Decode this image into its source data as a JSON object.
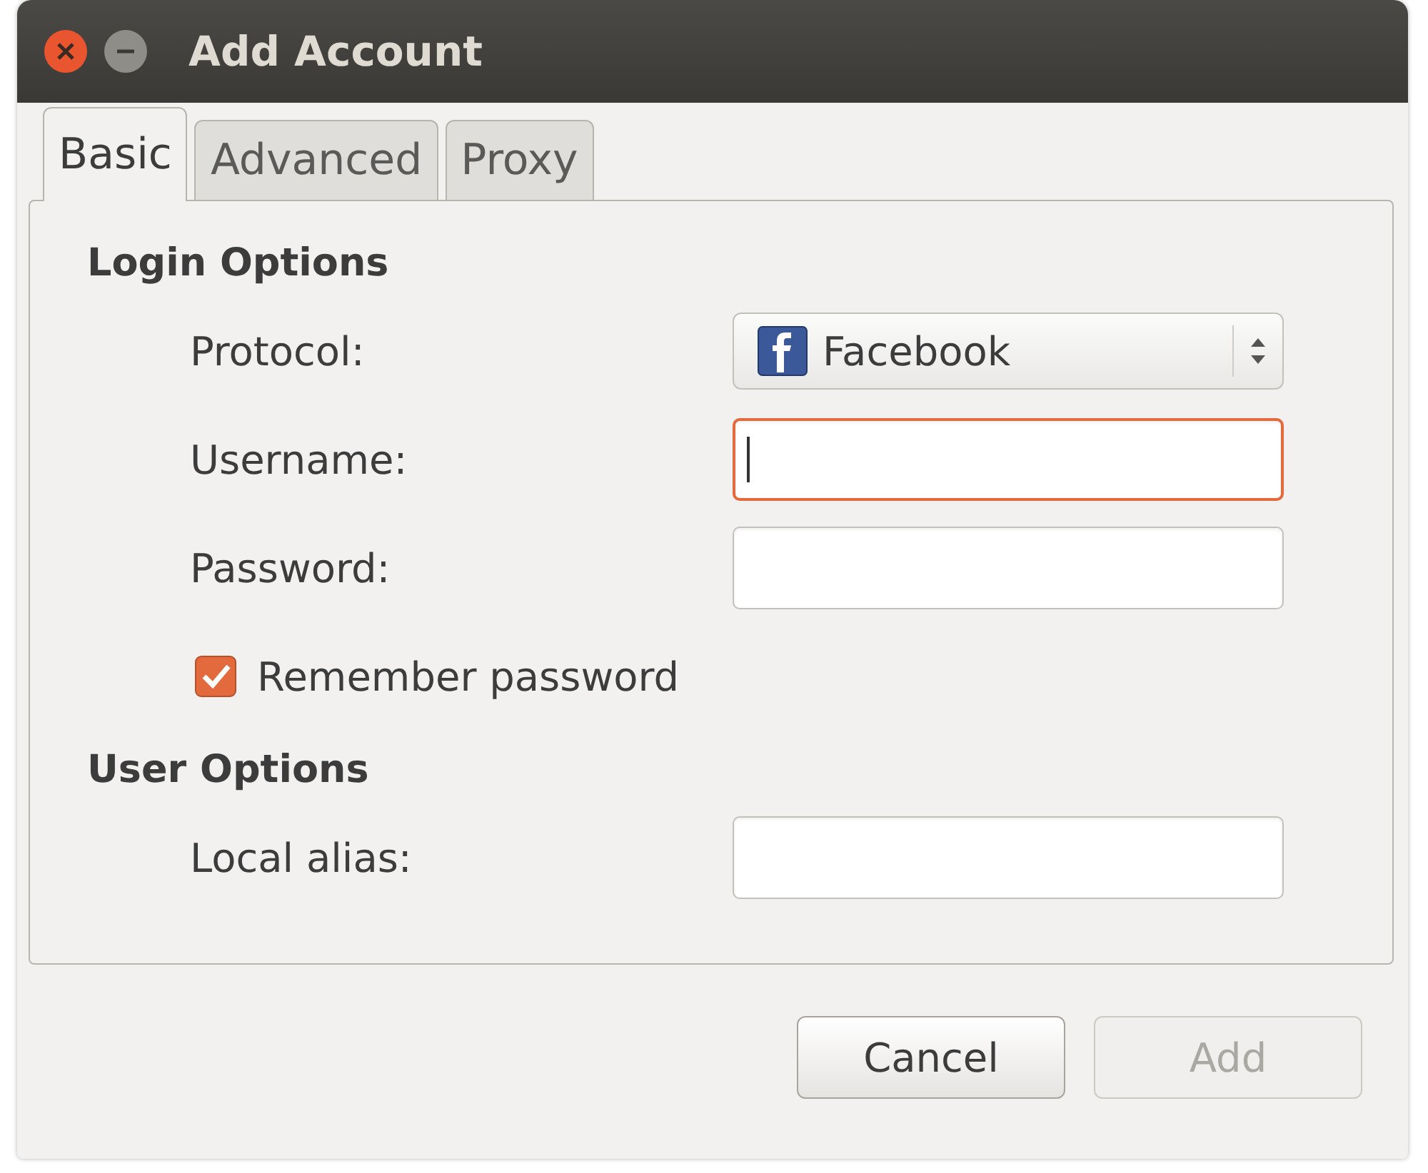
{
  "window": {
    "title": "Add Account"
  },
  "tabs": [
    {
      "label": "Basic",
      "selected": true
    },
    {
      "label": "Advanced",
      "selected": false
    },
    {
      "label": "Proxy",
      "selected": false
    }
  ],
  "sections": [
    {
      "title": "Login Options",
      "rows": [
        {
          "kind": "combo",
          "label": "Protocol:",
          "value": "Facebook"
        },
        {
          "kind": "entry",
          "label": "Username:",
          "focused": true
        },
        {
          "kind": "entry",
          "label": "Password:",
          "focused": false
        },
        {
          "kind": "check",
          "label": "Remember password",
          "checked": true
        }
      ]
    },
    {
      "title": "User Options",
      "rows": [
        {
          "kind": "entry",
          "label": "Local alias:",
          "focused": false
        }
      ]
    }
  ],
  "buttons": [
    {
      "label": "Cancel",
      "disabled": false
    },
    {
      "label": "Add",
      "disabled": true
    }
  ]
}
